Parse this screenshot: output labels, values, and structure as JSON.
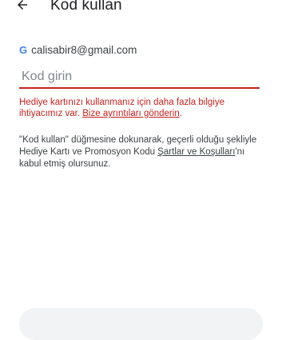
{
  "appbar": {
    "back_icon": "arrow-back-icon",
    "title": "Kod kullan"
  },
  "account": {
    "google_icon": "google-g-icon",
    "google_letter": "G",
    "email": "calisabir8@gmail.com"
  },
  "code_input": {
    "placeholder": "Kod girin",
    "value": ""
  },
  "error": {
    "text": "Hediye kartınızı kullanmanız için daha fazla bilgiye ihtiyacımız var.",
    "link": "Bize ayrıntıları gönderin",
    "suffix": "."
  },
  "terms": {
    "text_before": "\"Kod kullan\" düğmesine dokunarak, geçerli olduğu şekliyle Hediye Kartı ve Promosyon Kodu",
    "link": "Şartlar ve Koşulları",
    "text_after": "'nı kabul etmiş olursunuz."
  },
  "colors": {
    "error": "#c5221f",
    "button_bg": "#f1f3f4"
  }
}
